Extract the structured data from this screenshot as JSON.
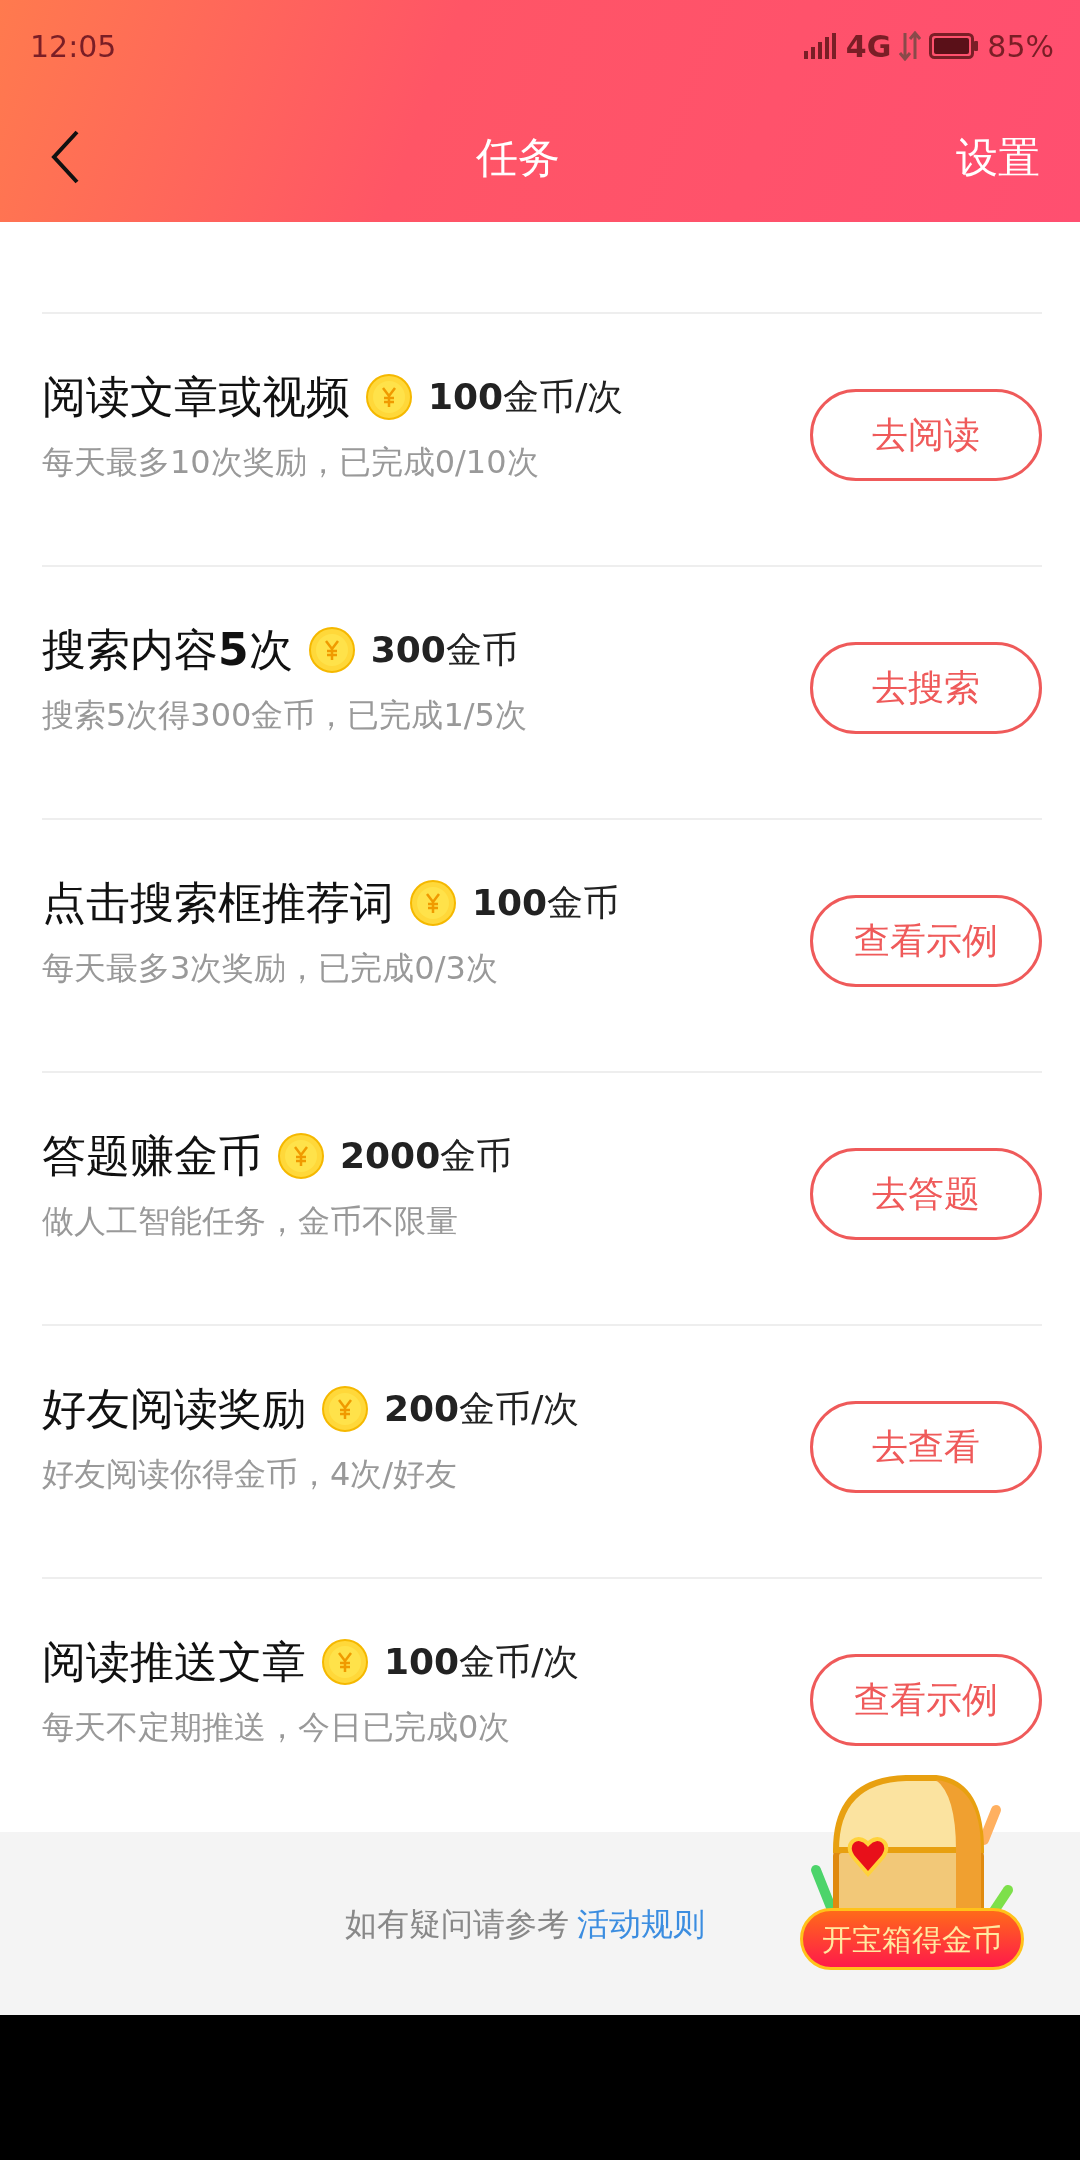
{
  "status_bar": {
    "time": "12:05",
    "network": "4G",
    "battery": "85%"
  },
  "header": {
    "title": "任务",
    "action": "设置"
  },
  "tasks": [
    {
      "title": "阅读文章或视频",
      "reward": "**100**金币/次",
      "desc": "每天最多10次奖励，已完成0/10次",
      "button": "去阅读"
    },
    {
      "title": "搜索内容**5**次",
      "reward": "**300**金币",
      "desc": "搜索5次得300金币，已完成1/5次",
      "button": "去搜索"
    },
    {
      "title": "点击搜索框推荐词",
      "reward": "**100**金币",
      "desc": "每天最多3次奖励，已完成0/3次",
      "button": "查看示例"
    },
    {
      "title": "答题赚金币",
      "reward": "**2000**金币",
      "desc": "做人工智能任务，金币不限量",
      "button": "去答题"
    },
    {
      "title": "好友阅读奖励",
      "reward": "**200**金币/次",
      "desc": "好友阅读你得金币，4次/好友",
      "button": "去查看"
    },
    {
      "title": "阅读推送文章",
      "reward": "**100**金币/次",
      "desc": "每天不定期推送，今日已完成0次",
      "button": "查看示例"
    }
  ],
  "footer": {
    "text": "如有疑问请参考",
    "link": "活动规则"
  },
  "chest_button": "开宝箱得金币"
}
